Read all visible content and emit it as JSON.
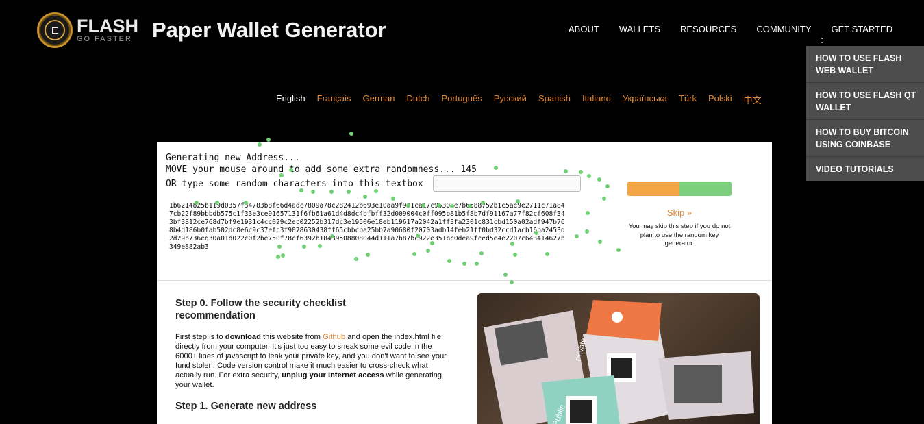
{
  "logo": {
    "name": "FLASH",
    "tagline": "GO FASTER"
  },
  "site_title": "Paper Wallet Generator",
  "nav": [
    "ABOUT",
    "WALLETS",
    "RESOURCES",
    "COMMUNITY",
    "GET STARTED"
  ],
  "dropdown": [
    "HOW TO USE FLASH WEB WALLET",
    "HOW TO USE FLASH QT WALLET",
    "HOW TO BUY BITCOIN USING COINBASE",
    "VIDEO TUTORIALS"
  ],
  "languages": [
    "English",
    "Français",
    "German",
    "Dutch",
    "Português",
    "Русский",
    "Spanish",
    "Italiano",
    "Українська",
    "Türk",
    "Polski",
    "中文"
  ],
  "active_language": "English",
  "generator": {
    "line1": "Generating new Address...",
    "line2_prefix": "MOVE your mouse around to add some extra randomness...",
    "counter": "145",
    "line3": "OR type some random characters into this textbox",
    "input_value": "",
    "hex": "1b6214825b119d0357f34783b8f66d4adc7809a78c282412b693e10aa9f931ca17c95302e7b6588752b1c5ae9e2711c71a847cb22f89bbbdb575c1f33e3ce91657131f6fb61a61d4d8dc4bfbff32d009004c0ff095b81b5f8b7df91167a77f82cf608f343bf3812ce768d7bf9e1931c4cc029c2ec02252b317dc3e19506e18eb119617a2042a1ff3fa2301c831cbd150a02adf947b768b4d186b0fab502dc8e6c9c37efc3f9078630438ff65cbbcba25bb7a90680f20703adb14feb21ff0bd32ccd1acb16ba2453d2d29b736ed30a01d022c0f2be750f78cf6392b18439508808044d111a7b87bc922e351bc0dea9fced5e4e2207c643414627b349e882ab3",
    "progress": 0.5,
    "skip_label": "Skip »",
    "skip_note": "You may skip this step if you do not plan to use the random key generator."
  },
  "step0": {
    "title": "Step 0. Follow the security checklist recommendation",
    "t1": "First step is to ",
    "b1": "download",
    "t2": " this website from ",
    "link": "Github",
    "t3": " and open the index.html file directly from your computer. It's just too easy to sneak some evil code in the 6000+ lines of javascript to leak your private key, and you don't want to see your fund stolen. Code version control make it much easier to cross-check what actually run. For extra security, ",
    "b2": "unplug your Internet access",
    "t4": " while generating your wallet."
  },
  "step1": {
    "title": "Step 1. Generate new address"
  },
  "photo": {
    "label_private": "Private",
    "label_public": "Public"
  },
  "colors": {
    "accent": "#e08a38",
    "progress_orange": "#f3a445",
    "progress_green": "#7ccf7c",
    "dot_green": "#6fcf74",
    "dropdown_bg": "#4d4d4d"
  }
}
